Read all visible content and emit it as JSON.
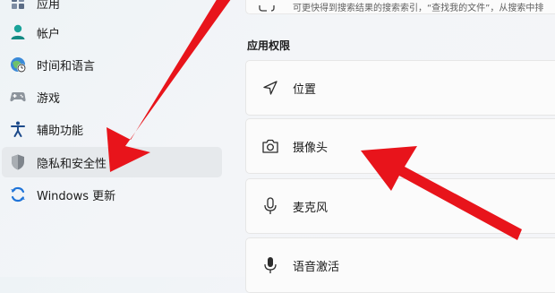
{
  "sidebar": {
    "items": [
      {
        "label": "应用",
        "icon": "apps-icon"
      },
      {
        "label": "帐户",
        "icon": "account-icon"
      },
      {
        "label": "时间和语言",
        "icon": "time-language-icon"
      },
      {
        "label": "游戏",
        "icon": "gaming-icon"
      },
      {
        "label": "辅助功能",
        "icon": "accessibility-icon"
      },
      {
        "label": "隐私和安全性",
        "icon": "shield-icon",
        "selected": true
      },
      {
        "label": "Windows 更新",
        "icon": "windows-update-icon"
      }
    ]
  },
  "main": {
    "top_card": {
      "description": "可更快得到搜索结果的搜索索引，“查找我的文件”，从搜索中排"
    },
    "section_title": "应用权限",
    "permissions": [
      {
        "label": "位置",
        "icon": "location-icon"
      },
      {
        "label": "摄像头",
        "icon": "camera-icon"
      },
      {
        "label": "麦克风",
        "icon": "microphone-icon"
      },
      {
        "label": "语音激活",
        "icon": "voice-activation-icon"
      }
    ]
  },
  "colors": {
    "arrow": "#e8141b",
    "selected_background": "#e6e9ec",
    "card_background": "#fbfbfb"
  }
}
